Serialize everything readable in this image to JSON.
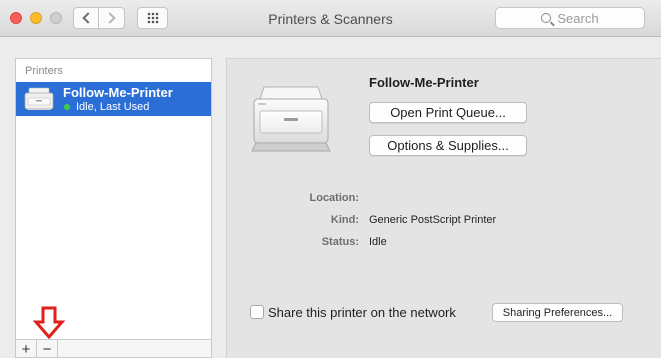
{
  "window": {
    "title": "Printers & Scanners"
  },
  "toolbar": {
    "back_icon": "chevron-left-icon",
    "forward_icon": "chevron-right-icon",
    "show_all_icon": "grid-icon",
    "search_placeholder": "Search"
  },
  "printer_list": {
    "header": "Printers",
    "items": [
      {
        "name": "Follow-Me-Printer",
        "status": "Idle, Last Used",
        "selected": true,
        "status_color": "#3ccf44"
      }
    ],
    "add_label": "+",
    "remove_label": "−"
  },
  "annotation": {
    "icon": "down-arrow-icon",
    "color": "#e0201b"
  },
  "detail": {
    "name": "Follow-Me-Printer",
    "open_queue_label": "Open Print Queue...",
    "options_label": "Options & Supplies...",
    "info": {
      "location_label": "Location:",
      "location_value": "",
      "kind_label": "Kind:",
      "kind_value": "Generic PostScript Printer",
      "status_label": "Status:",
      "status_value": "Idle"
    },
    "share_label": "Share this printer on the network",
    "share_checked": false,
    "sharing_prefs_label": "Sharing Preferences..."
  },
  "colors": {
    "selection": "#2b6fd6",
    "window_bg": "#ececec",
    "panel_bg": "#e4e4e4"
  }
}
